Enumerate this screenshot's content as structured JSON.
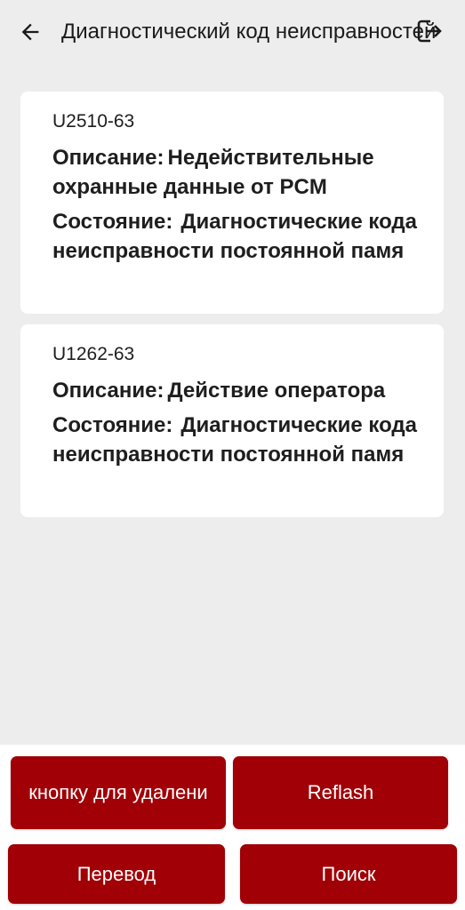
{
  "header": {
    "title": "Диагностический код неисправностей",
    "back_icon": "arrow-left-icon",
    "exit_icon": "exit-icon"
  },
  "dtcs": [
    {
      "code": "U2510-63",
      "description_label": "Описание:",
      "description": "Недействительные охранные данные от PCM",
      "status_label": "Состояние:",
      "status": "Диагностические кода неисправности постоянной памя"
    },
    {
      "code": "U1262-63",
      "description_label": "Описание:",
      "description": "Действие оператора",
      "status_label": "Состояние:",
      "status": "Диагностические кода неисправности постоянной памя"
    }
  ],
  "buttons": {
    "delete": "кнопку для удалени",
    "reflash": "Reflash",
    "translate": "Перевод",
    "search": "Поиск"
  },
  "colors": {
    "accent": "#a00006",
    "background": "#ededed",
    "card": "#ffffff"
  }
}
